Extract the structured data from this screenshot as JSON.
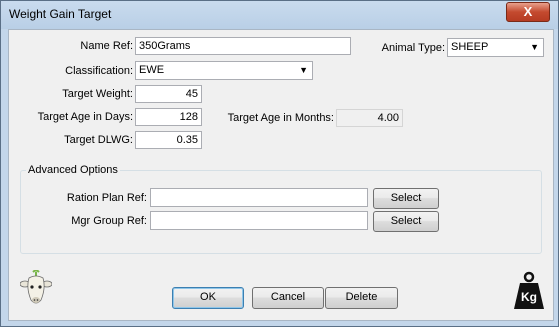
{
  "window": {
    "title": "Weight Gain Target",
    "close_glyph": "X"
  },
  "form": {
    "name_ref": {
      "label": "Name Ref:",
      "value": "350Grams"
    },
    "animal_type": {
      "label": "Animal Type:",
      "value": "SHEEP"
    },
    "classification": {
      "label": "Classification:",
      "value": "EWE"
    },
    "target_weight": {
      "label": "Target Weight:",
      "value": "45"
    },
    "target_age_days": {
      "label": "Target Age in Days:",
      "value": "128"
    },
    "target_age_months": {
      "label": "Target Age in Months:",
      "value": "4.00"
    },
    "target_dlwg": {
      "label": "Target DLWG:",
      "value": "0.35"
    }
  },
  "advanced": {
    "legend": "Advanced Options",
    "ration_plan": {
      "label": "Ration Plan Ref:",
      "value": "",
      "button": "Select"
    },
    "mgr_group": {
      "label": "Mgr Group Ref:",
      "value": "",
      "button": "Select"
    }
  },
  "buttons": {
    "ok": "OK",
    "cancel": "Cancel",
    "delete": "Delete"
  },
  "icons": {
    "left": "sheep-icon",
    "right": "kg-weight-icon",
    "kg_text": "Kg"
  },
  "colors": {
    "frame": "#c3d6ea",
    "client": "#f0f0f0",
    "close": "#c44a2f",
    "default_border": "#3c7fb1"
  }
}
